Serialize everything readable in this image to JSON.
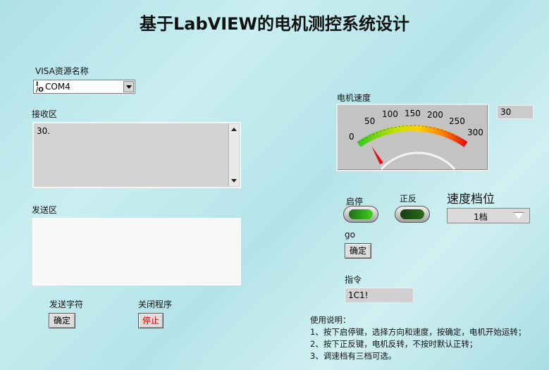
{
  "title": "基于LabVIEW的电机测控系统设计",
  "visa": {
    "label": "VISA资源名称",
    "icon_text": "I/O",
    "value": "COM4"
  },
  "receive": {
    "label": "接收区",
    "value": "30."
  },
  "send": {
    "label": "发送区",
    "value": ""
  },
  "send_char": {
    "label": "发送字符",
    "button": "确定"
  },
  "close_program": {
    "label": "关闭程序",
    "button": "停止"
  },
  "speed": {
    "label": "电机速度",
    "value": 30,
    "display": "30",
    "scale_labels": [
      "0",
      "50",
      "100",
      "150",
      "200",
      "250",
      "300"
    ],
    "range": [
      0,
      300
    ]
  },
  "start_stop": {
    "label": "启停",
    "state": "on"
  },
  "direction": {
    "label": "正反",
    "state": "off"
  },
  "speed_gear": {
    "label": "速度档位",
    "value": "1档"
  },
  "go": {
    "label": "go",
    "button": "确定"
  },
  "command": {
    "label": "指令",
    "value": "1C1!"
  },
  "instructions": {
    "title": "使用说明：",
    "lines": [
      "1、按下启停键，选择方向和速度，按确定，电机开始运转；",
      "2、按下正反键，电机反转，不按时默认正转；",
      "3、调速档有三档可选。"
    ]
  },
  "colors": {
    "background": "#b9e6ea",
    "led_on": "#3fd11e",
    "led_off": "#1d4e13",
    "stop_text": "#e00000"
  }
}
